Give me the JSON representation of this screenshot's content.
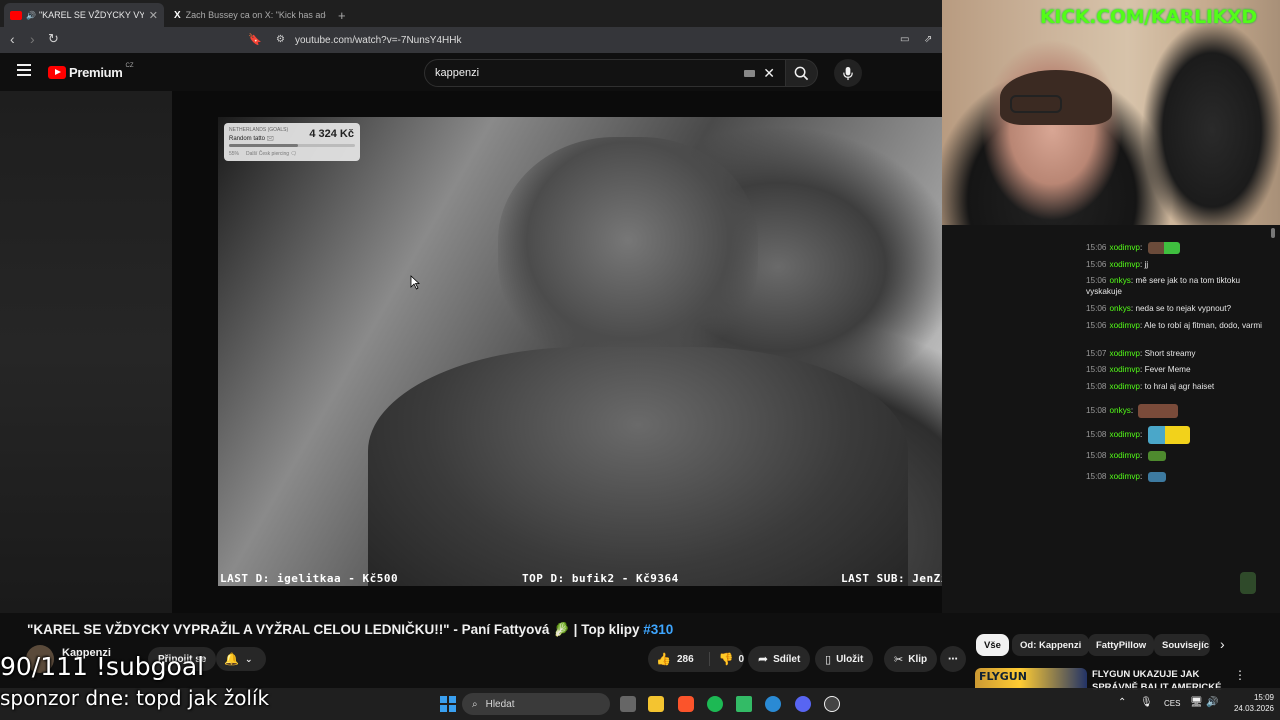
{
  "browser": {
    "tabs": [
      {
        "title": "\"KAREL SE VŽDYCKY VYPRAŽ",
        "active": true
      },
      {
        "title": "Zach Bussey ca on X: \"Kick has added",
        "active": false
      }
    ],
    "new_tab": "+",
    "url": "youtube.com/watch?v=-7NunsY4HHk"
  },
  "youtube": {
    "logo_text": "Premium",
    "region": "CZ",
    "search_value": "kappenzi",
    "video": {
      "title": "\"KAREL SE VŽDYCKY VYPRAŽIL A VYŽRAL CELOU LEDNIČKU!!\" - Paní Fattyová 🥬 | Top klipy ",
      "hashtag": "#310",
      "overlay_last_d": "LAST D: igelitkaa - Kč500",
      "overlay_top_d": "TOP D: bufik2 - Kč9364",
      "overlay_last_sub": "LAST SUB: JenZikky",
      "goal_card": {
        "label": "NETHERLANDS (GOALS)",
        "name": "Random tatto 🖂",
        "amount": "4 324 Kč",
        "percent": "55%",
        "note": "Další Česk piercing 🗨"
      }
    },
    "channel": {
      "name": "Kappenzi",
      "join_label": "Připojit se"
    },
    "actions": {
      "likes": "286",
      "dislikes": "0",
      "share": "Sdílet",
      "save": "Uložit",
      "clip": "Klip",
      "more": "⋯"
    },
    "chips": [
      "Vše",
      "Od: Kappenzi",
      "FattyPillow",
      "Souvisejíc"
    ],
    "rec_title_1": "FLYGUN UKAZUJE JAK",
    "rec_title_2": "SPRÁVNĚ BALIT AMERICKÉ",
    "rec_thumb_text": "FLYGUN"
  },
  "stream": {
    "kick_label": "KICK.COM/KARLIKXD",
    "subgoal": "90/111 !subgoal",
    "sponsor": "sponzor dne: topd jak žolík",
    "chat": [
      {
        "time": "15:06",
        "user": "xodimvp",
        "msg": "",
        "emote": "w"
      },
      {
        "time": "15:06",
        "user": "xodimvp",
        "msg": "jj"
      },
      {
        "time": "15:06",
        "user": "onkys",
        "msg": "mě sere jak to na tom tiktoku vyskakuje"
      },
      {
        "time": "15:06",
        "user": "onkys",
        "msg": "neda se to nejak vypnout?"
      },
      {
        "time": "15:06",
        "user": "xodimvp",
        "msg": "Ale to robí aj fitman, dodo, varmi"
      },
      {
        "time": "15:07",
        "user": "xodimvp",
        "msg": "Short streamy"
      },
      {
        "time": "15:08",
        "user": "xodimvp",
        "msg": "Fever Meme"
      },
      {
        "time": "15:08",
        "user": "xodimvp",
        "msg": "to hral aj agr haiset"
      },
      {
        "time": "15:08",
        "user": "onkys",
        "msg": "",
        "emote": "food"
      },
      {
        "time": "15:08",
        "user": "xodimvp",
        "msg": "",
        "emote": "yellow"
      },
      {
        "time": "15:08",
        "user": "xodimvp",
        "msg": "",
        "emote": "pickle"
      },
      {
        "time": "15:08",
        "user": "xodimvp",
        "msg": "",
        "emote": "pickle2"
      }
    ]
  },
  "taskbar": {
    "search_placeholder": "Hledat",
    "lang": "CES",
    "time": "15:09",
    "date": "24.03.2026"
  },
  "colors": {
    "kick_green": "#53fc18",
    "yt_red": "#ff0000",
    "link_blue": "#3ea6ff"
  }
}
